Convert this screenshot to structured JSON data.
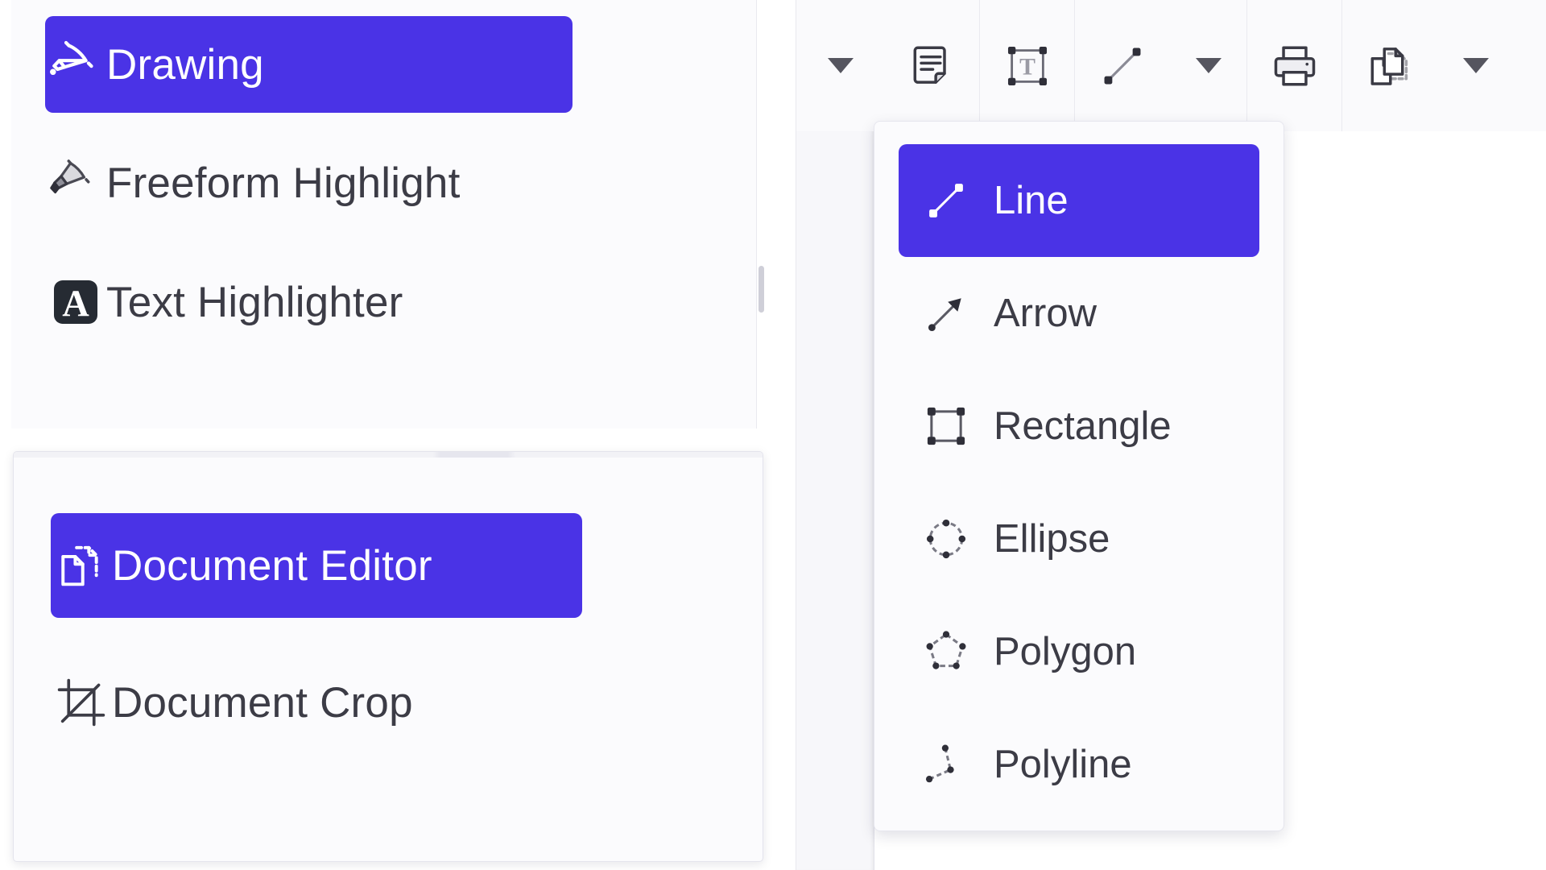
{
  "accent_color": "#4a33e6",
  "panel_bg": "#fbfbfd",
  "text_color": "#3c3c46",
  "drawing_tools_panel": {
    "items": [
      {
        "label": "Drawing",
        "icon": "highlighter-pen-icon",
        "selected": true
      },
      {
        "label": "Freeform Highlight",
        "icon": "marker-highlight-icon",
        "selected": false
      },
      {
        "label": "Text Highlighter",
        "icon": "text-highlight-a-icon",
        "selected": false
      }
    ]
  },
  "document_tools_panel": {
    "items": [
      {
        "label": "Document Editor",
        "icon": "document-copy-icon",
        "selected": true
      },
      {
        "label": "Document Crop",
        "icon": "crop-icon",
        "selected": false
      }
    ]
  },
  "toolbar": {
    "items": [
      {
        "name": "caret-left",
        "icon": "chevron-down-icon",
        "type": "caret"
      },
      {
        "name": "sticky-note",
        "icon": "note-document-icon",
        "type": "button"
      },
      {
        "name": "text-box",
        "icon": "text-box-t-icon",
        "type": "button"
      },
      {
        "name": "line-shape",
        "icon": "line-shape-icon",
        "type": "button"
      },
      {
        "name": "shapes-caret",
        "icon": "chevron-down-icon",
        "type": "caret"
      },
      {
        "name": "print",
        "icon": "printer-icon",
        "type": "button"
      },
      {
        "name": "document-copy",
        "icon": "document-copy-icon",
        "type": "button"
      },
      {
        "name": "overflow-caret",
        "icon": "chevron-down-icon",
        "type": "caret"
      }
    ]
  },
  "shapes_dropdown": {
    "items": [
      {
        "label": "Line",
        "icon": "line-shape-icon",
        "selected": true
      },
      {
        "label": "Arrow",
        "icon": "arrow-shape-icon",
        "selected": false
      },
      {
        "label": "Rectangle",
        "icon": "rectangle-shape-icon",
        "selected": false
      },
      {
        "label": "Ellipse",
        "icon": "ellipse-shape-icon",
        "selected": false
      },
      {
        "label": "Polygon",
        "icon": "polygon-shape-icon",
        "selected": false
      },
      {
        "label": "Polyline",
        "icon": "polyline-shape-icon",
        "selected": false
      }
    ]
  }
}
